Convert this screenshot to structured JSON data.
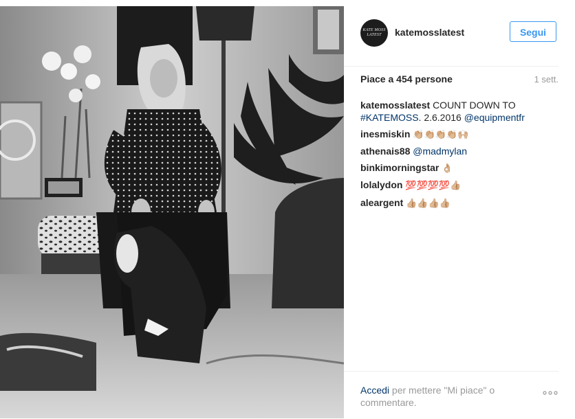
{
  "post": {
    "image_alt": "Black and white photo of a woman seated in an armchair with a dog, in a living room with plants",
    "author": {
      "username": "katemosslatest",
      "avatar_text": "KATE MOSS LATEST"
    },
    "follow_label": "Segui",
    "likes_text": "Piace a 454 persone",
    "time_ago": "1 sett.",
    "caption": {
      "user": "katemosslatest",
      "text_before": "COUNT DOWN TO",
      "hashtag": "#KATEMOSS",
      "text_mid": ". 2.6.2016",
      "mention": "@equipmentfr"
    },
    "comments": [
      {
        "user": "inesmiskin",
        "text": "👏🏼👏🏼👏🏼👏🏼🙌🏼"
      },
      {
        "user": "athenais88",
        "mention": "@madmylan"
      },
      {
        "user": "binkimorningstar",
        "text": "👌🏼"
      },
      {
        "user": "lolalydon",
        "text": "💯💯💯💯👍🏼"
      },
      {
        "user": "aleargent",
        "text": "👍🏼👍🏼👍🏼👍🏼"
      }
    ],
    "footer": {
      "login_link": "Accedi",
      "login_text": "per mettere \"Mi piace\" o commentare."
    },
    "icons": {
      "more": "more-options-icon"
    }
  }
}
